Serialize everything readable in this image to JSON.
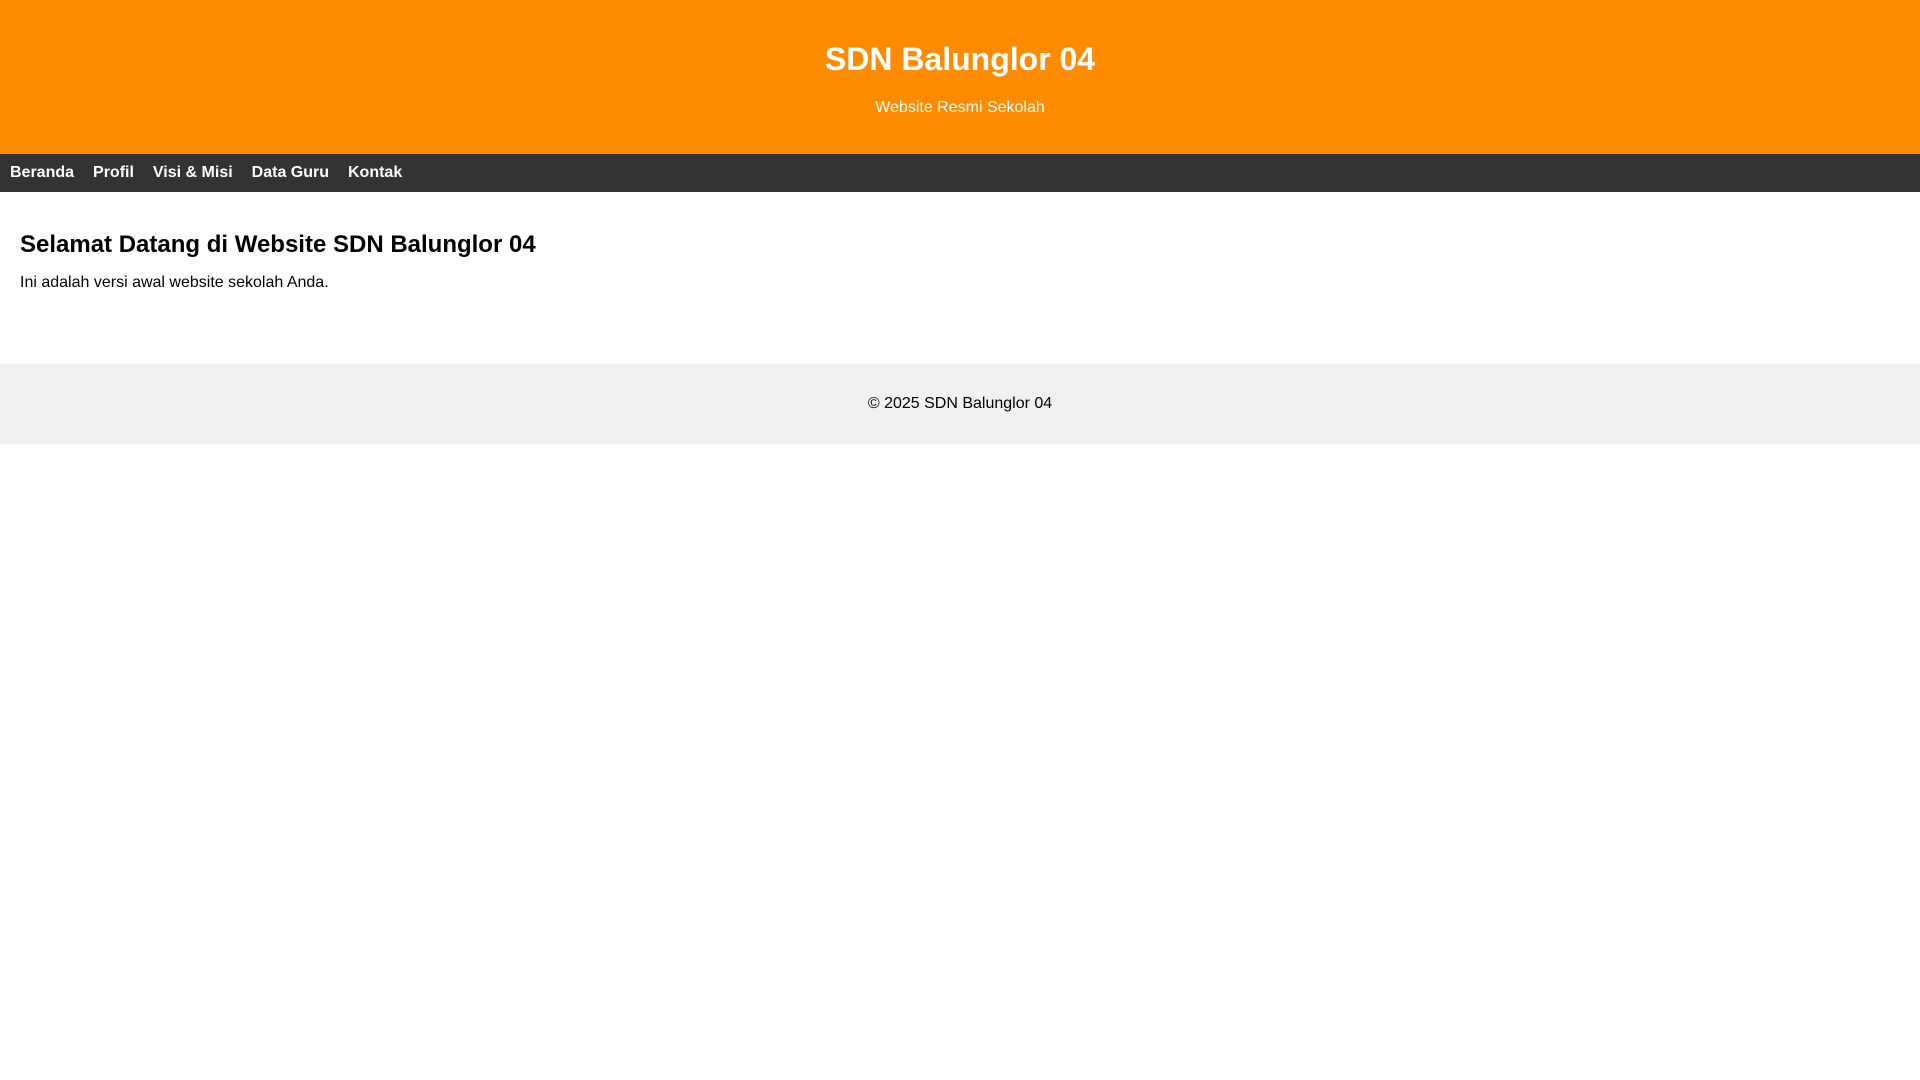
{
  "header": {
    "title": "SDN Balunglor 04",
    "subtitle": "Website Resmi Sekolah"
  },
  "nav": {
    "items": [
      {
        "label": "Beranda"
      },
      {
        "label": "Profil"
      },
      {
        "label": "Visi & Misi"
      },
      {
        "label": "Data Guru"
      },
      {
        "label": "Kontak"
      }
    ]
  },
  "main": {
    "heading": "Selamat Datang di Website SDN Balunglor 04",
    "text": "Ini adalah versi awal website sekolah Anda."
  },
  "footer": {
    "text": "© 2025 SDN Balunglor 04"
  },
  "colors": {
    "header_bg": "#ff8c00",
    "nav_bg": "#333333",
    "footer_bg": "#f1f1f1"
  }
}
